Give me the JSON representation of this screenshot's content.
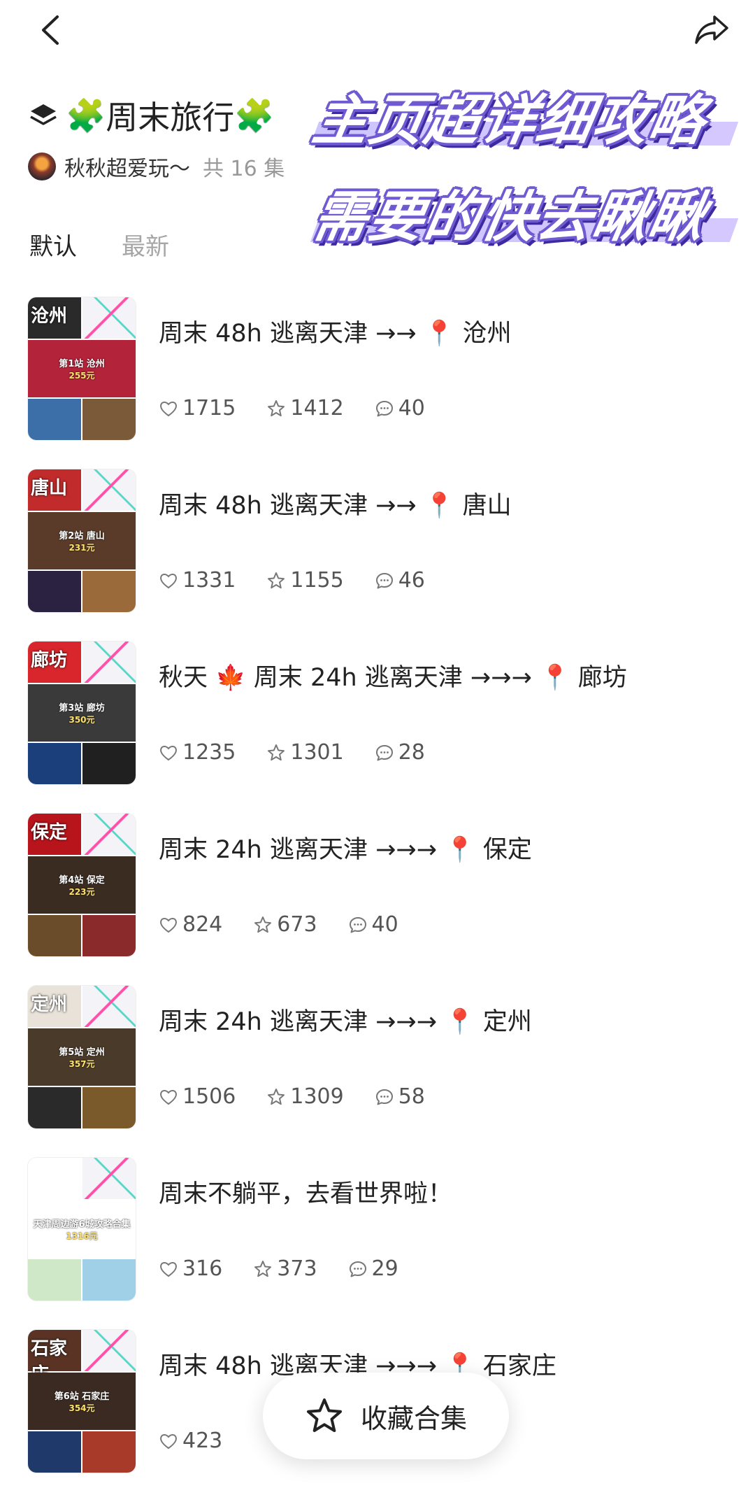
{
  "header": {
    "title": "周末旅行",
    "title_emoji": "🧩",
    "author": "秋秋超爱玩～",
    "episode_count": "共 16 集"
  },
  "banner": {
    "line1": "主页超详细攻略",
    "line2": "需要的快去瞅瞅"
  },
  "sort_tabs": [
    {
      "label": "默认",
      "active": true
    },
    {
      "label": "最新",
      "active": false
    }
  ],
  "items": [
    {
      "title": "周末 48h 逃离天津 →→ 📍 沧州",
      "likes": "1715",
      "stars": "1412",
      "comments": "40",
      "thumb": {
        "big": "沧州",
        "line": "第1站 沧州",
        "price": "255元",
        "colors": [
          "#2a2a2a",
          "#b3233a",
          "#3c6fa8",
          "#7b5a3a"
        ]
      }
    },
    {
      "title": "周末 48h 逃离天津 →→ 📍 唐山",
      "likes": "1331",
      "stars": "1155",
      "comments": "46",
      "thumb": {
        "big": "唐山",
        "line": "第2站 唐山",
        "price": "231元",
        "colors": [
          "#c22b2b",
          "#5a3b2a",
          "#2b2140",
          "#9a6a3a"
        ]
      }
    },
    {
      "title": "秋天 🍁 周末 24h 逃离天津 →→→ 📍 廊坊",
      "likes": "1235",
      "stars": "1301",
      "comments": "28",
      "thumb": {
        "big": "廊坊",
        "line": "第3站 廊坊",
        "price": "350元",
        "colors": [
          "#d8262c",
          "#3a3a3a",
          "#1a3f7a",
          "#202020"
        ]
      }
    },
    {
      "title": "周末 24h 逃离天津 →→→ 📍 保定",
      "likes": "824",
      "stars": "673",
      "comments": "40",
      "thumb": {
        "big": "保定",
        "line": "第4站 保定",
        "price": "223元",
        "colors": [
          "#b8141c",
          "#3b2c22",
          "#6a4b2a",
          "#8a2a2a"
        ]
      }
    },
    {
      "title": "周末 24h 逃离天津 →→→ 📍 定州",
      "likes": "1506",
      "stars": "1309",
      "comments": "58",
      "thumb": {
        "big": "定州",
        "line": "第5站 定州",
        "price": "357元",
        "colors": [
          "#e8e2d8",
          "#4a3a2a",
          "#2a2a2a",
          "#7a5a2a"
        ]
      }
    },
    {
      "title": "周末不躺平，去看世界啦！",
      "likes": "316",
      "stars": "373",
      "comments": "29",
      "thumb": {
        "big": "",
        "line": "天津周边游6城攻略合集",
        "price": "1316元",
        "colors": [
          "#ffffff",
          "#ffffff",
          "#cfe8c8",
          "#9fd0e8"
        ]
      }
    },
    {
      "title": "周末 48h 逃离天津 →→→ 📍 石家庄",
      "likes": "423",
      "stars": "",
      "comments": "",
      "thumb": {
        "big": "石家庄",
        "line": "第6站 石家庄",
        "price": "354元",
        "colors": [
          "#5a3324",
          "#3a2a22",
          "#1f3a6a",
          "#a83a2a"
        ]
      }
    }
  ],
  "fab": {
    "label": "收藏合集"
  }
}
